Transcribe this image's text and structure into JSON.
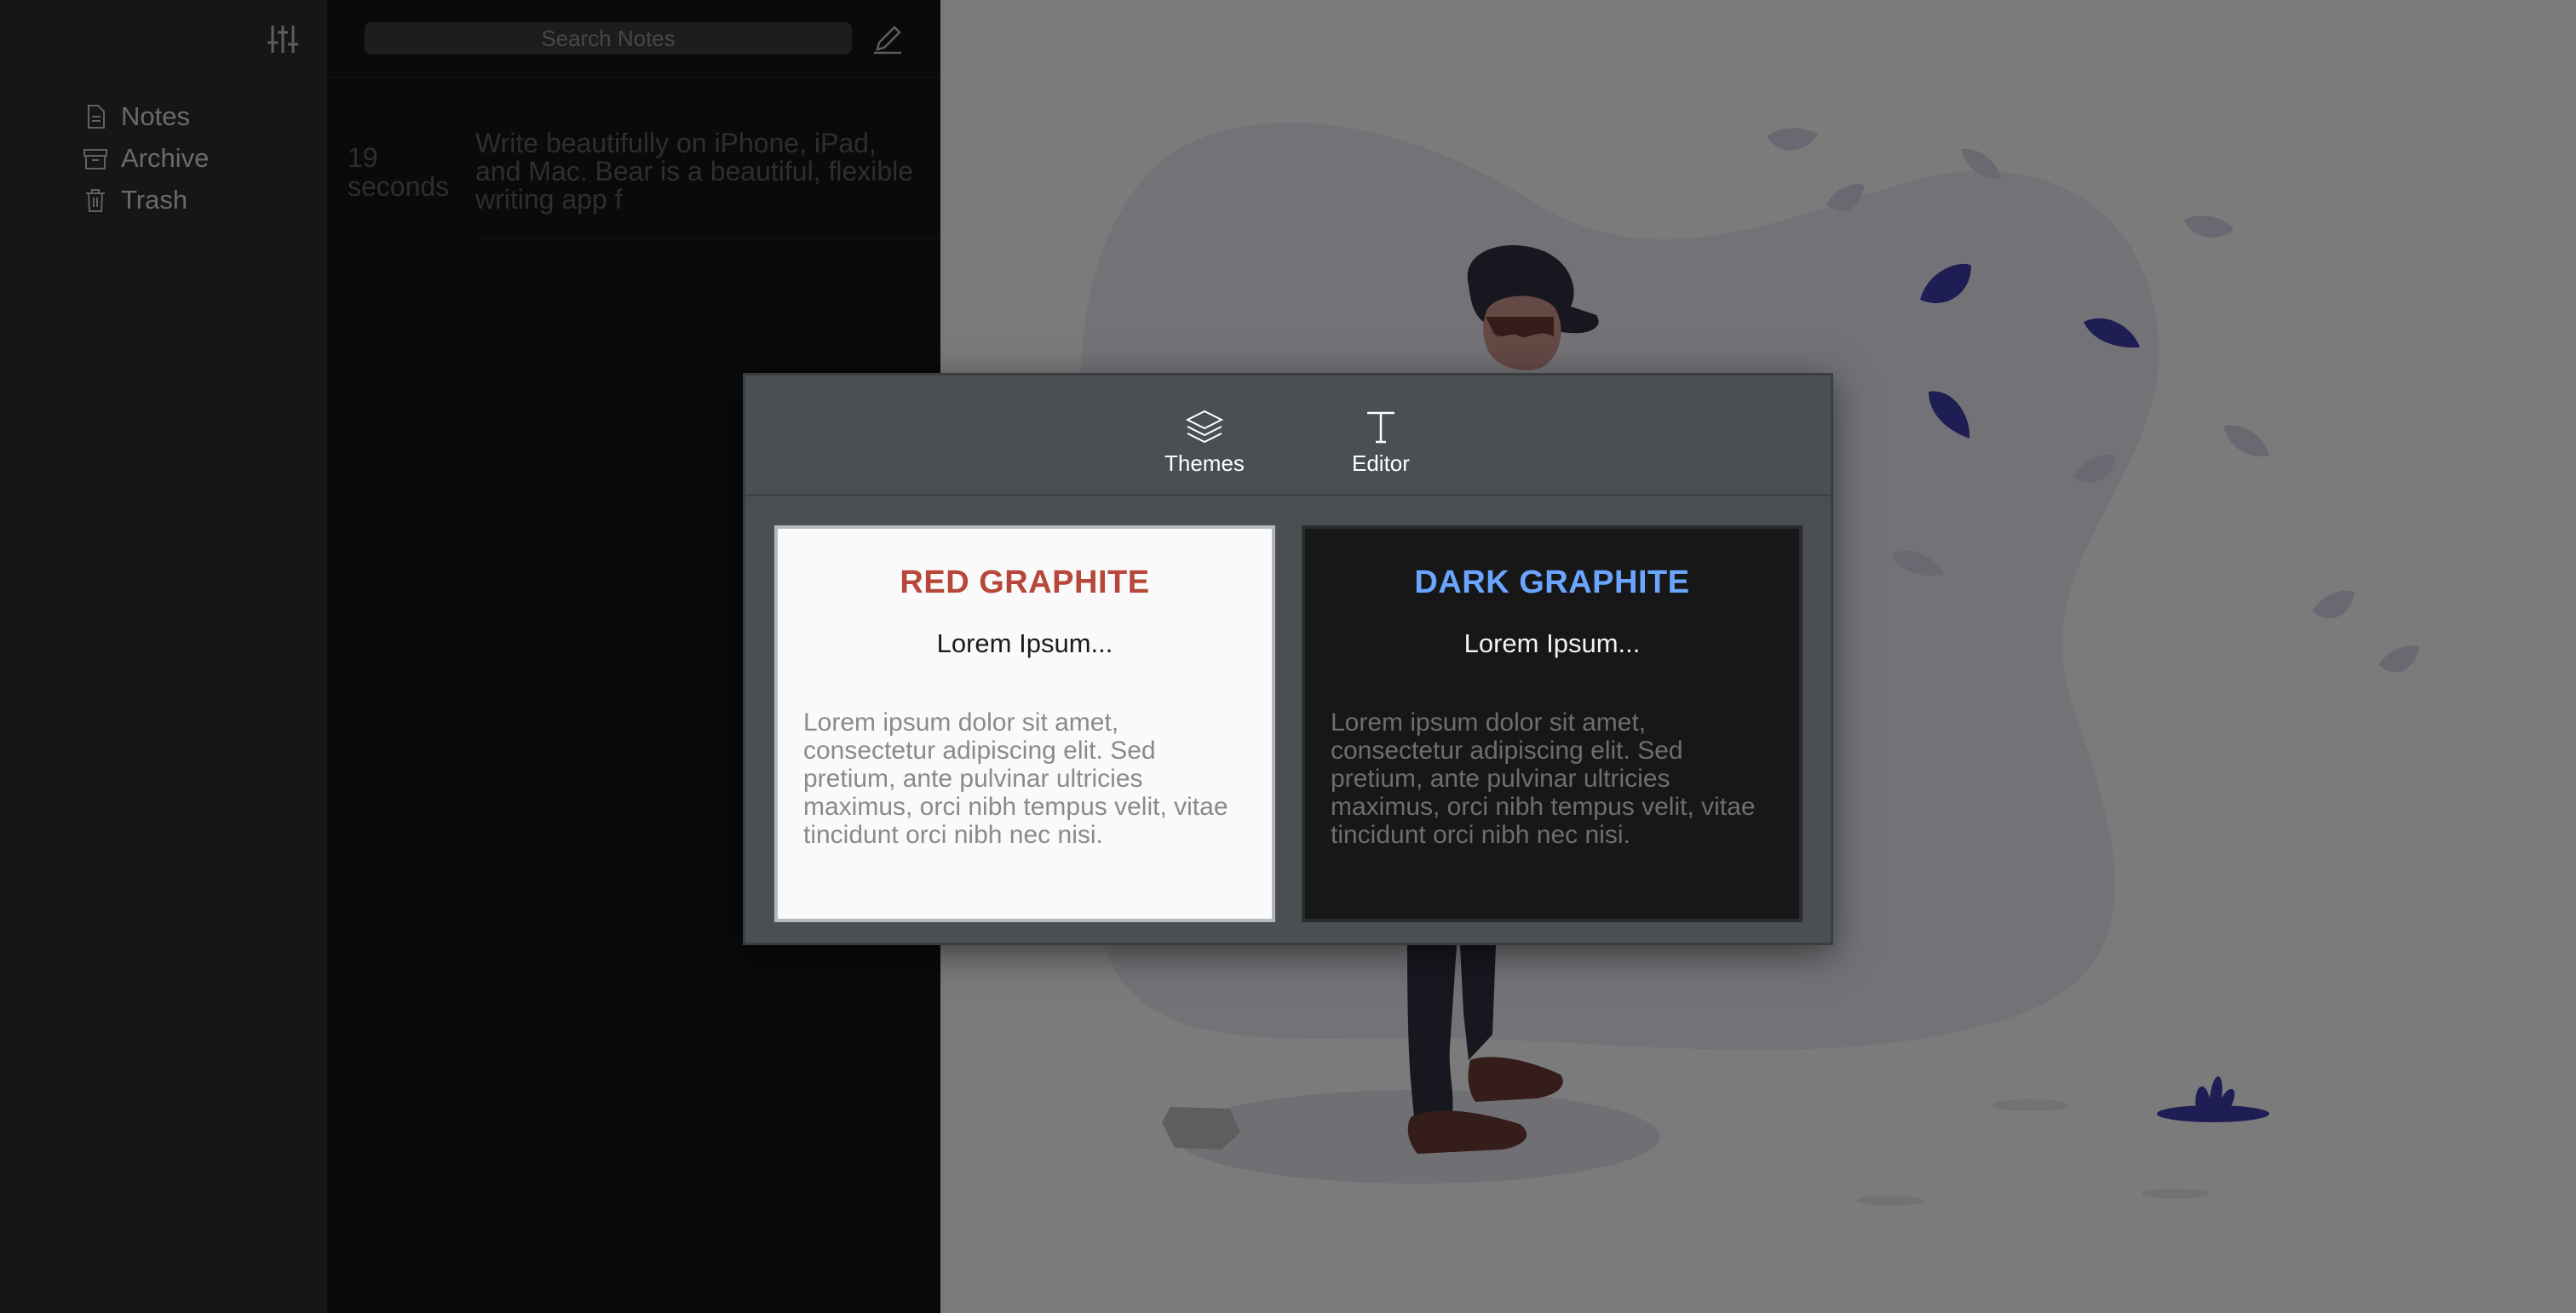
{
  "sidebar": {
    "items": [
      {
        "label": "Notes",
        "icon": "note-icon"
      },
      {
        "label": "Archive",
        "icon": "archive-icon"
      },
      {
        "label": "Trash",
        "icon": "trash-icon"
      }
    ]
  },
  "notelist": {
    "search_placeholder": "Search Notes",
    "notes": [
      {
        "time": "19 seconds",
        "preview": "Write beautifully on iPhone, iPad, and Mac. Bear is a beautiful, flexible writing app f"
      }
    ]
  },
  "modal": {
    "tabs": [
      {
        "label": "Themes",
        "icon": "layers-icon"
      },
      {
        "label": "Editor",
        "icon": "text-icon"
      }
    ],
    "themes": [
      {
        "name": "RED GRAPHITE",
        "accent": "#b6473a",
        "subtitle": "Lorem Ipsum...",
        "body": "Lorem ipsum dolor sit amet, consectetur adipiscing elit. Sed pretium, ante pulvinar ultricies maximus, orci nibh tempus velit, vitae tincidunt orci nibh nec nisi."
      },
      {
        "name": "DARK GRAPHITE",
        "accent": "#6aa6ff",
        "subtitle": "Lorem Ipsum...",
        "body": "Lorem ipsum dolor sit amet, consectetur adipiscing elit. Sed pretium, ante pulvinar ultricies maximus, orci nibh tempus velit, vitae tincidunt orci nibh nec nisi."
      }
    ]
  },
  "colors": {
    "sidebar_bg": "#2b2c2f",
    "notelist_bg": "#141414",
    "editor_bg": "#f7f7f9",
    "modal_bg": "#4a4f53",
    "illustration_accent": "#3f3da8"
  }
}
